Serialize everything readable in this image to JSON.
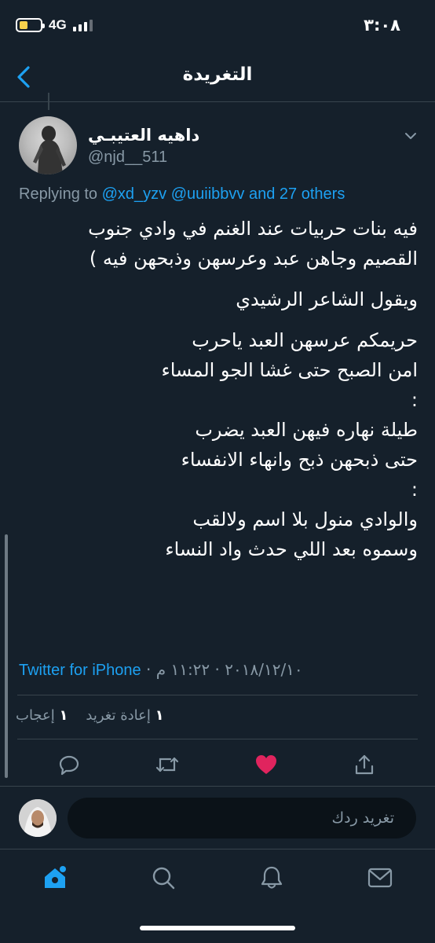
{
  "status_bar": {
    "network": "4G",
    "time": "٣:٠٨"
  },
  "header": {
    "title": "التغريدة"
  },
  "tweet": {
    "author_name": "داهيه العتيبـي",
    "handle": "@njd__511",
    "replying_prefix": "Replying to",
    "replying_to": [
      "@xd_yzv",
      "@uuiibbvv",
      "and 27 others"
    ],
    "paragraphs": [
      "فيه بنات حربيات عند الغنم في وادي جنوب\nالقصيم وجاهن عبد وعرسهن وذبحهن فيه )",
      "ويقول الشاعر الرشيدي",
      "حريمكم عرسهن العبد ياحرب\nامن الصبح حتى غشا الجو المساء\n:\nطيلة نهاره فيهن العبد يضرب\nحتى ذبحهن ذبح وانهاء الانفساء\n:\nوالوادي منول بلا اسم ولالقب\nوسموه بعد اللي حدث واد النساء"
    ],
    "source": "Twitter for iPhone",
    "timestamp": "٢٠١٨/١٢/١٠ · ١١:٢٢ م",
    "likes_count": "١",
    "likes_label": "إعجاب",
    "retweets_count": "١",
    "retweets_label": "إعادة تغريد"
  },
  "reply_box": {
    "placeholder": "تغريد ردك"
  },
  "colors": {
    "background": "#15202b",
    "accent": "#1da1f2",
    "like": "#e0245e",
    "muted": "#8899a6"
  },
  "icons": [
    "back-chevron-icon",
    "caret-down-icon",
    "reply-icon",
    "retweet-icon",
    "heart-icon",
    "share-icon",
    "home-icon",
    "search-icon",
    "notifications-icon",
    "messages-icon"
  ]
}
